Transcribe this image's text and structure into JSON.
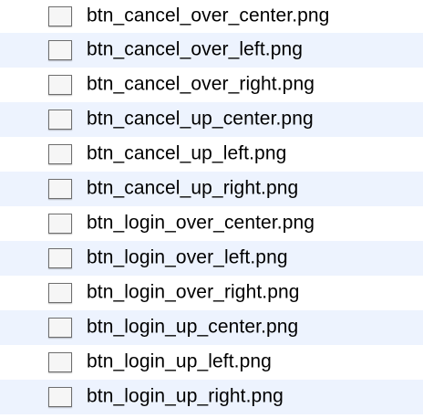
{
  "files": [
    {
      "name": "btn_cancel_over_center.png",
      "icon": "image-file-icon"
    },
    {
      "name": "btn_cancel_over_left.png",
      "icon": "image-file-icon"
    },
    {
      "name": "btn_cancel_over_right.png",
      "icon": "image-file-icon"
    },
    {
      "name": "btn_cancel_up_center.png",
      "icon": "image-file-icon"
    },
    {
      "name": "btn_cancel_up_left.png",
      "icon": "image-file-icon"
    },
    {
      "name": "btn_cancel_up_right.png",
      "icon": "image-file-icon"
    },
    {
      "name": "btn_login_over_center.png",
      "icon": "image-file-icon"
    },
    {
      "name": "btn_login_over_left.png",
      "icon": "image-file-icon"
    },
    {
      "name": "btn_login_over_right.png",
      "icon": "image-file-icon"
    },
    {
      "name": "btn_login_up_center.png",
      "icon": "image-file-icon"
    },
    {
      "name": "btn_login_up_left.png",
      "icon": "image-file-icon"
    },
    {
      "name": "btn_login_up_right.png",
      "icon": "image-file-icon"
    }
  ],
  "colors": {
    "row_even": "#ffffff",
    "row_odd": "#edf3fe",
    "text": "#000000"
  }
}
